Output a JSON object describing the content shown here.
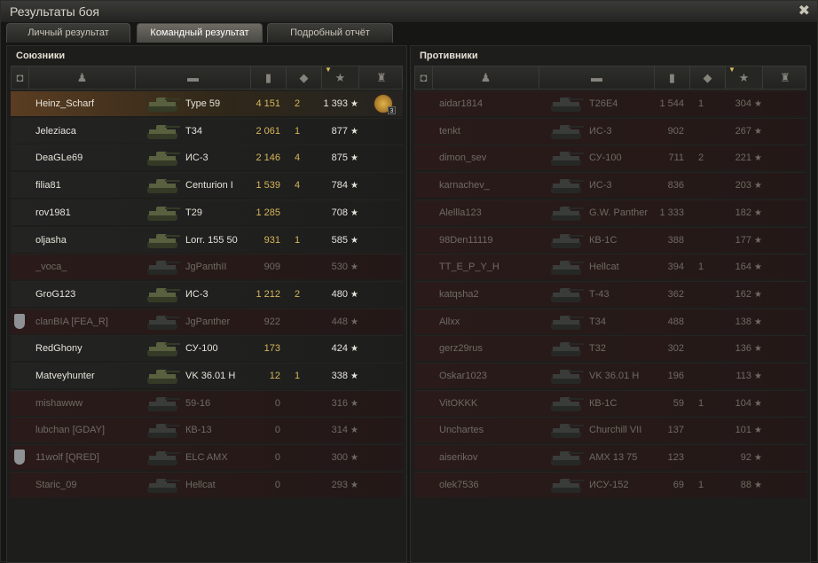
{
  "window": {
    "title": "Результаты боя"
  },
  "tabs": [
    {
      "label": "Личный результат",
      "active": false
    },
    {
      "label": "Командный результат",
      "active": true
    },
    {
      "label": "Подробный отчёт",
      "active": false
    }
  ],
  "allies": {
    "title": "Союзники",
    "rows": [
      {
        "player": "Heinz_Scharf",
        "tank": "Type 59",
        "damage": "4 151",
        "kills": "2",
        "xp": "1 393",
        "alive": true,
        "highlight": true,
        "medal": "3"
      },
      {
        "player": "Jeleziaca",
        "tank": "Т34",
        "damage": "2 061",
        "kills": "1",
        "xp": "877",
        "alive": true
      },
      {
        "player": "DeaGLe69",
        "tank": "ИС-3",
        "damage": "2 146",
        "kills": "4",
        "xp": "875",
        "alive": true
      },
      {
        "player": "filia81",
        "tank": "Centurion I",
        "damage": "1 539",
        "kills": "4",
        "xp": "784",
        "alive": true
      },
      {
        "player": "rov1981",
        "tank": "T29",
        "damage": "1 285",
        "kills": "",
        "xp": "708",
        "alive": true
      },
      {
        "player": "oljasha",
        "tank": "Lorr. 155 50",
        "damage": "931",
        "kills": "1",
        "xp": "585",
        "alive": true
      },
      {
        "player": "_voca_",
        "tank": "JgPanthII",
        "damage": "909",
        "kills": "",
        "xp": "530",
        "alive": false
      },
      {
        "player": "GroG123",
        "tank": "ИС-3",
        "damage": "1 212",
        "kills": "2",
        "xp": "480",
        "alive": true
      },
      {
        "player": "clanBIA [FEA_R]",
        "tank": "JgPanther",
        "damage": "922",
        "kills": "",
        "xp": "448",
        "alive": false,
        "badge": true
      },
      {
        "player": "RedGhony",
        "tank": "СУ-100",
        "damage": "173",
        "kills": "",
        "xp": "424",
        "alive": true
      },
      {
        "player": "Matveyhunter",
        "tank": "VK 36.01 H",
        "damage": "12",
        "kills": "1",
        "xp": "338",
        "alive": true
      },
      {
        "player": "mishawww",
        "tank": "59-16",
        "damage": "0",
        "kills": "",
        "xp": "316",
        "alive": false
      },
      {
        "player": "lubchan [GDAY]",
        "tank": "КВ-13",
        "damage": "0",
        "kills": "",
        "xp": "314",
        "alive": false
      },
      {
        "player": "11wolf [QRED]",
        "tank": "ELC AMX",
        "damage": "0",
        "kills": "",
        "xp": "300",
        "alive": false,
        "badge": true
      },
      {
        "player": "Staric_09",
        "tank": "Hellcat",
        "damage": "0",
        "kills": "",
        "xp": "293",
        "alive": false
      }
    ]
  },
  "enemies": {
    "title": "Противники",
    "rows": [
      {
        "player": "aidar1814",
        "tank": "T26E4",
        "damage": "1 544",
        "kills": "1",
        "xp": "304",
        "alive": false
      },
      {
        "player": "tenkt",
        "tank": "ИС-3",
        "damage": "902",
        "kills": "",
        "xp": "267",
        "alive": false
      },
      {
        "player": "dimon_sev",
        "tank": "СУ-100",
        "damage": "711",
        "kills": "2",
        "xp": "221",
        "alive": false
      },
      {
        "player": "karnachev_",
        "tank": "ИС-3",
        "damage": "836",
        "kills": "",
        "xp": "203",
        "alive": false
      },
      {
        "player": "Alellla123",
        "tank": "G.W. Panther",
        "damage": "1 333",
        "kills": "",
        "xp": "182",
        "alive": false
      },
      {
        "player": "98Den11119",
        "tank": "КВ-1С",
        "damage": "388",
        "kills": "",
        "xp": "177",
        "alive": false
      },
      {
        "player": "TT_E_P_Y_H",
        "tank": "Hellcat",
        "damage": "394",
        "kills": "1",
        "xp": "164",
        "alive": false
      },
      {
        "player": "katqsha2",
        "tank": "Т-43",
        "damage": "362",
        "kills": "",
        "xp": "162",
        "alive": false
      },
      {
        "player": "Allxx",
        "tank": "Т34",
        "damage": "488",
        "kills": "",
        "xp": "138",
        "alive": false
      },
      {
        "player": "gerz29rus",
        "tank": "T32",
        "damage": "302",
        "kills": "",
        "xp": "136",
        "alive": false
      },
      {
        "player": "Oskar1023",
        "tank": "VK 36.01 H",
        "damage": "196",
        "kills": "",
        "xp": "113",
        "alive": false
      },
      {
        "player": "VitOKKK",
        "tank": "КВ-1С",
        "damage": "59",
        "kills": "1",
        "xp": "104",
        "alive": false
      },
      {
        "player": "Unchartes",
        "tank": "Churchill VII",
        "damage": "137",
        "kills": "",
        "xp": "101",
        "alive": false
      },
      {
        "player": "aiserikov",
        "tank": "AMX 13 75",
        "damage": "123",
        "kills": "",
        "xp": "92",
        "alive": false
      },
      {
        "player": "olek7536",
        "tank": "ИСУ-152",
        "damage": "69",
        "kills": "1",
        "xp": "88",
        "alive": false
      }
    ]
  },
  "icons": {
    "close": "close-icon",
    "header": [
      "clan-badge-icon",
      "player-icon",
      "tank-icon",
      "damage-icon",
      "kills-icon",
      "xp-star-icon",
      "medal-icon"
    ],
    "star": "★"
  },
  "colors": {
    "damage": "#d6b65a",
    "highlight": "#5a3d22",
    "dead_row": "#2a1b1a"
  }
}
